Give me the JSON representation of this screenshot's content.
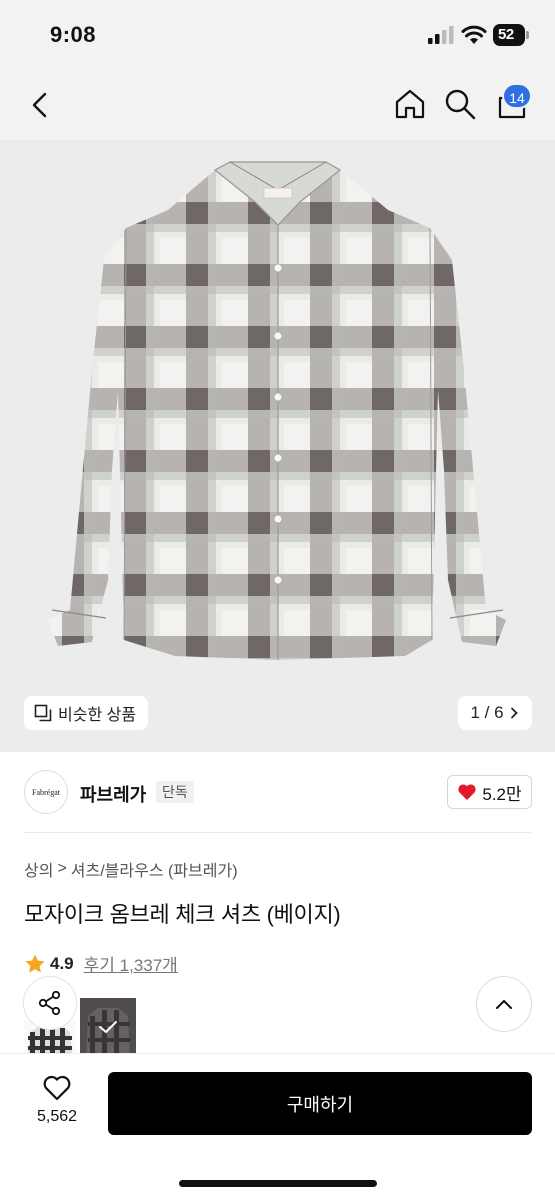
{
  "status_bar": {
    "time": "9:08",
    "battery": "52"
  },
  "nav": {
    "cart_count": "14",
    "icons": [
      "back-icon",
      "home-icon",
      "search-icon",
      "cart-icon"
    ]
  },
  "gallery": {
    "similar_label": "비슷한 상품",
    "pager": "1 / 6",
    "shirt_colors": {
      "base": "#d4d8d2",
      "check": "#6f6563",
      "light": "#eef0ec",
      "background": "#ececec"
    }
  },
  "brand": {
    "logo_text": "Fabrégat",
    "name": "파브레가",
    "tag": "단독",
    "likes": "5.2만"
  },
  "breadcrumb": {
    "category": "상의",
    "subcategory": "셔츠/블라우스 (파브레가)"
  },
  "product": {
    "title": "모자이크 옴브레 체크 셔츠 (베이지)"
  },
  "rating": {
    "score": "4.9",
    "reviews": "후기 1,337개"
  },
  "bottom_bar": {
    "wish_count": "5,562",
    "buy_label": "구매하기"
  },
  "colors": {
    "accent_badge": "#2f6fe4",
    "heart": "#e0192b",
    "star": "#f5a623",
    "buy_button": "#000000"
  }
}
